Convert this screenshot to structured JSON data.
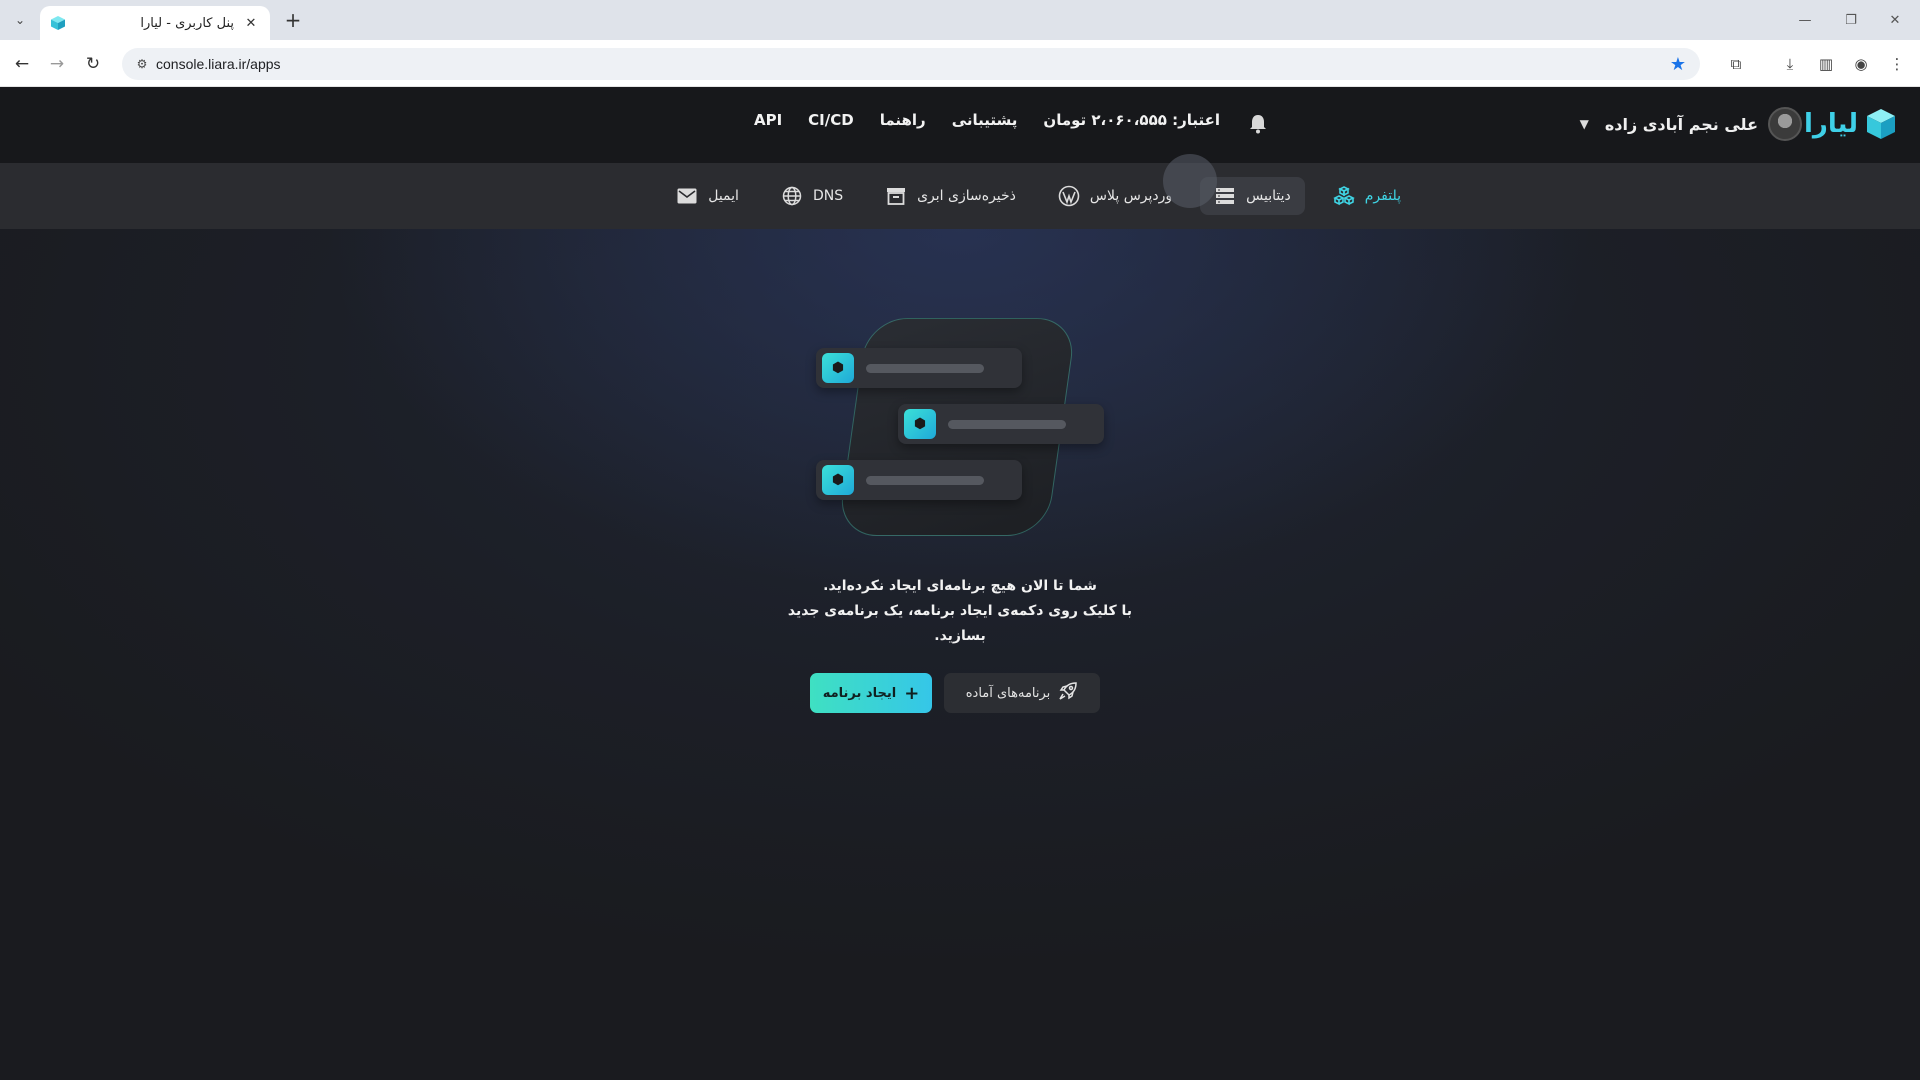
{
  "browser": {
    "tab_title": "پنل کاربری - لیارا",
    "url": "console.liara.ir/apps"
  },
  "header": {
    "logo_text": "لیارا",
    "user_name": "علی نجم آبادی زاده",
    "nav": [
      "اعتبار: ۲،۰۶۰،۵۵۵ تومان",
      "پشتیبانی",
      "راهنما",
      "CI/CD",
      "API"
    ]
  },
  "subnav": {
    "items": [
      {
        "label": "پلتفرم",
        "icon": "platform-icon"
      },
      {
        "label": "دیتابیس",
        "icon": "database-icon"
      },
      {
        "label": "وردپرس پلاس",
        "icon": "wordpress-icon"
      },
      {
        "label": "ذخیره‌سازی ابری",
        "icon": "storage-icon"
      },
      {
        "label": "DNS",
        "icon": "globe-icon"
      },
      {
        "label": "ایمیل",
        "icon": "mail-icon"
      }
    ]
  },
  "empty_state": {
    "line1": "شما تا الان هیچ برنامه‌ای ایجاد نکرده‌اید.",
    "line2": "با کلیک روی دکمه‌ی ایجاد برنامه، یک برنامه‌ی جدید",
    "line3": "بسازید."
  },
  "actions": {
    "create_label": "ایجاد برنامه",
    "ready_label": "برنامه‌های آماده"
  },
  "colors": {
    "accent": "#3fd4e4",
    "header_bg": "#17181b",
    "subnav_bg": "#2b2c30"
  }
}
